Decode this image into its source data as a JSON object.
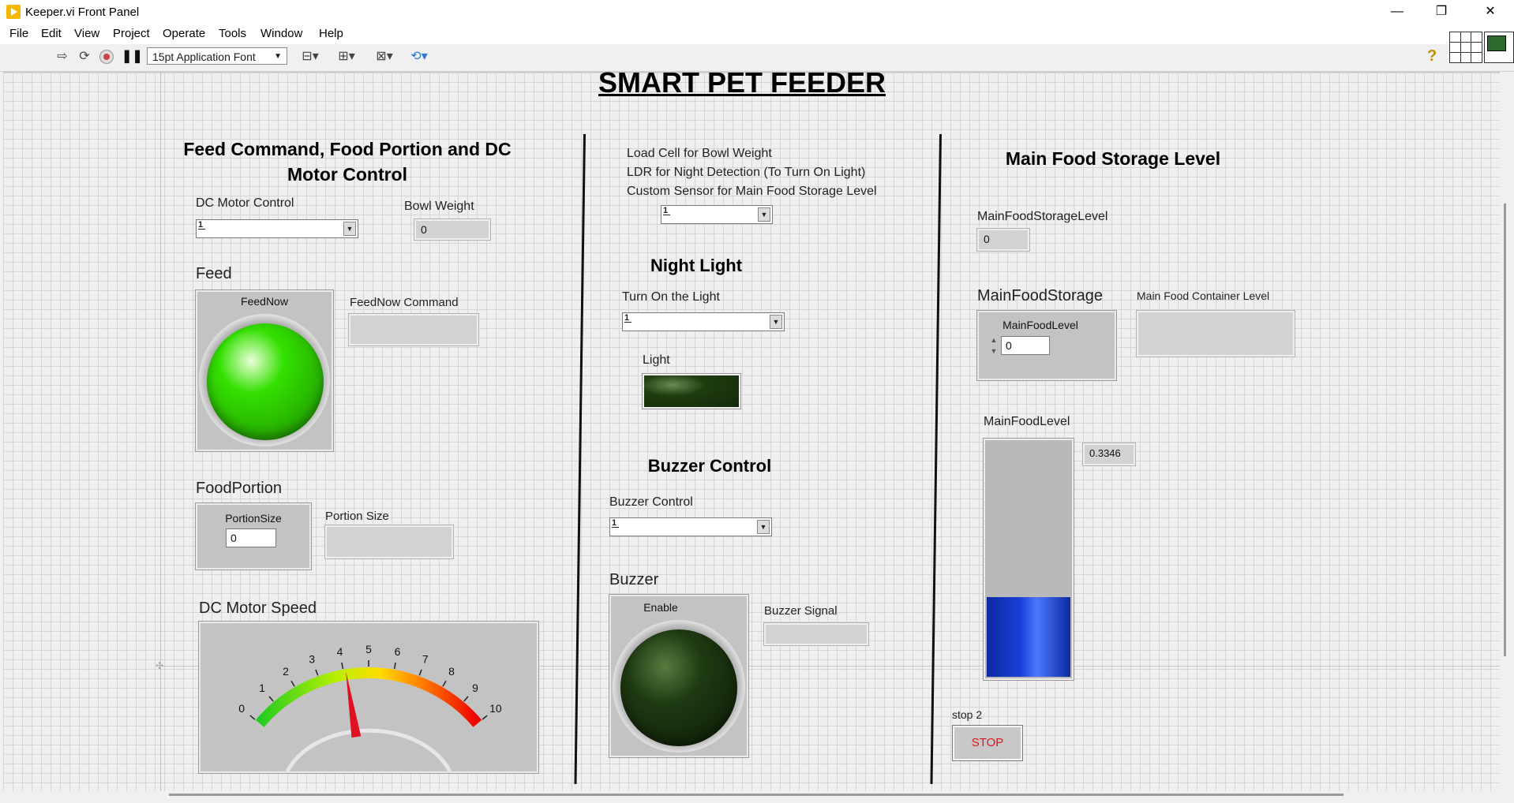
{
  "window": {
    "title": "Keeper.vi Front Panel",
    "minimize": "—",
    "restore": "❐",
    "close": "✕"
  },
  "menu": [
    "File",
    "Edit",
    "View",
    "Project",
    "Operate",
    "Tools",
    "Window",
    "Help"
  ],
  "toolbar": {
    "font_select": "15pt Application Font",
    "help_icon": "?"
  },
  "panel_title": "SMART PET FEEDER",
  "left": {
    "heading": "Feed Command, Food Portion and DC Motor Control",
    "dc_motor_label": "DC Motor Control",
    "bowl_weight_label": "Bowl Weight",
    "bowl_weight_value": "0",
    "feed_section": "Feed",
    "feednow_label": "FeedNow",
    "feednow_state": "on",
    "feednow_color": "#33e000",
    "feednow_cmd_label": "FeedNow Command",
    "foodportion_section": "FoodPortion",
    "portionsize_label": "PortionSize",
    "portionsize_value": "0",
    "portion_size_label": "Portion Size",
    "motor_speed_section": "DC Motor Speed"
  },
  "middle": {
    "sensor_line1": "Load Cell for Bowl Weight",
    "sensor_line2": "LDR for Night Detection (To Turn On Light)",
    "sensor_line3": "Custom Sensor for Main Food Storage Level",
    "night_light_heading": "Night Light",
    "turn_on_label": "Turn On the Light",
    "light_label": "Light",
    "light_state": "off",
    "light_color": "#1f3d10",
    "buzzer_heading": "Buzzer Control",
    "buzzer_control_label": "Buzzer Control",
    "buzzer_section": "Buzzer",
    "enable_label": "Enable",
    "enable_state": "off",
    "enable_color": "#1e3a12",
    "buzzer_signal_label": "Buzzer Signal"
  },
  "right": {
    "heading": "Main Food Storage Level",
    "storage_level_label": "MainFoodStorageLevel",
    "storage_level_value": "0",
    "storage_section": "MainFoodStorage",
    "mainfoodlevel_ctl_label": "MainFoodLevel",
    "mainfoodlevel_ctl_value": "0",
    "container_level_label": "Main Food Container Level",
    "tank_label": "MainFoodLevel",
    "tank_value_text": "0.3346",
    "tank_fill_fraction": 0.3346,
    "tank_fill_color": "#1a3fd8",
    "stop_caption": "stop 2",
    "stop_button": "STOP"
  },
  "gauge": {
    "min": 0,
    "max": 10,
    "value": 4.1,
    "ticks": [
      "0",
      "1",
      "2",
      "3",
      "4",
      "5",
      "6",
      "7",
      "8",
      "9",
      "10"
    ]
  }
}
